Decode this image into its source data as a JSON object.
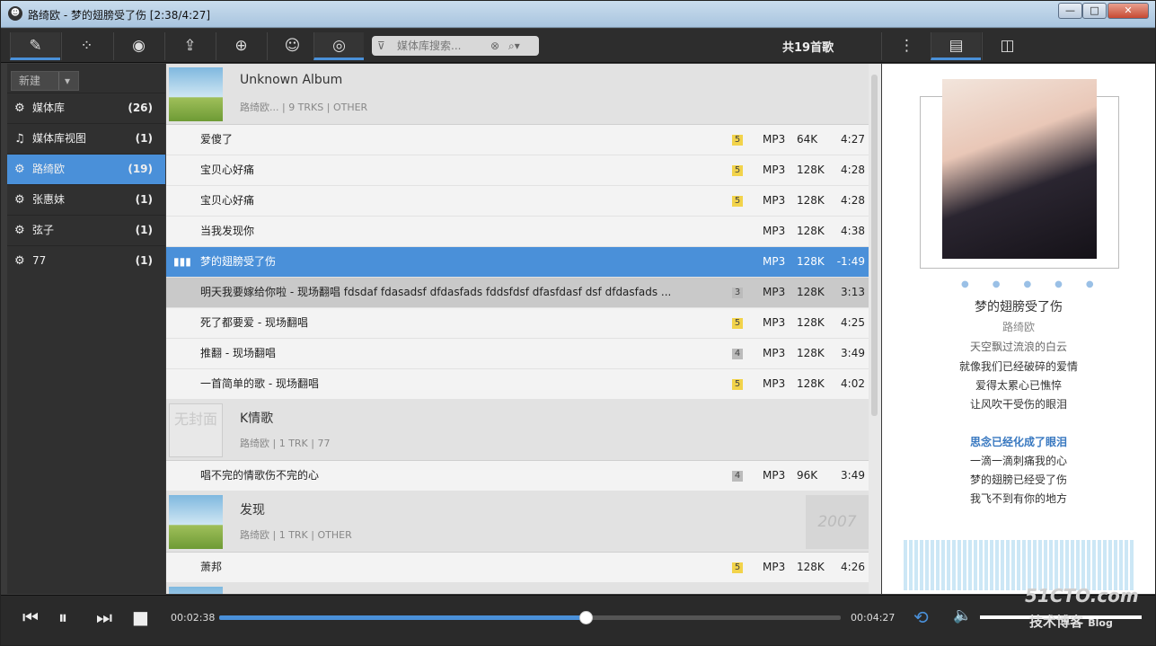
{
  "window": {
    "title": "路绮欧 - 梦的翅膀受了伤 [2:38/4:27]",
    "min": "—",
    "max": "□",
    "close": "✕"
  },
  "toolbar": {
    "search_placeholder": "媒体库搜索...",
    "track_count": "共19首歌"
  },
  "sidebar": {
    "new_label": "新建",
    "items": [
      {
        "label": "媒体库",
        "count": "(26)",
        "icon": "gear-icon"
      },
      {
        "label": "媒体库视图",
        "count": "(1)",
        "icon": "music-note-icon"
      },
      {
        "label": "路绮欧",
        "count": "(19)",
        "icon": "gear-icon"
      },
      {
        "label": "张惠妹",
        "count": "(1)",
        "icon": "gear-icon"
      },
      {
        "label": "弦子",
        "count": "(1)",
        "icon": "gear-icon"
      },
      {
        "label": "77",
        "count": "(1)",
        "icon": "gear-icon"
      }
    ]
  },
  "albums": [
    {
      "name": "Unknown Album",
      "meta": "路绮欧... | 9 TRKS | OTHER"
    },
    {
      "name": "K情歌",
      "meta": "路绮欧 | 1 TRK | 77",
      "cover_text": "无封面"
    },
    {
      "name": "发现",
      "meta": "路绮欧 | 1 TRK | OTHER",
      "year": "2007"
    }
  ],
  "tracks": [
    {
      "name": "爱傻了",
      "rating": "5",
      "format": "MP3",
      "bitrate": "64K",
      "duration": "4:27"
    },
    {
      "name": "宝贝心好痛",
      "rating": "5",
      "format": "MP3",
      "bitrate": "128K",
      "duration": "4:28"
    },
    {
      "name": "宝贝心好痛",
      "rating": "5",
      "format": "MP3",
      "bitrate": "128K",
      "duration": "4:28"
    },
    {
      "name": "当我发现你",
      "rating": "",
      "format": "MP3",
      "bitrate": "128K",
      "duration": "4:38"
    },
    {
      "name": "梦的翅膀受了伤",
      "rating": "",
      "format": "MP3",
      "bitrate": "128K",
      "duration": "-1:49"
    },
    {
      "name": "明天我要嫁给你啦 - 现场翻唱 fdsdaf fdasadsf dfdasfads fddsfdsf dfasfdasf dsf dfdasfads ...",
      "rating": "3",
      "format": "MP3",
      "bitrate": "128K",
      "duration": "3:13"
    },
    {
      "name": "死了都要爱 - 现场翻唱",
      "rating": "5",
      "format": "MP3",
      "bitrate": "128K",
      "duration": "4:25"
    },
    {
      "name": "推翻 - 现场翻唱",
      "rating": "4",
      "format": "MP3",
      "bitrate": "128K",
      "duration": "3:49"
    },
    {
      "name": "一首简单的歌 - 现场翻唱",
      "rating": "5",
      "format": "MP3",
      "bitrate": "128K",
      "duration": "4:02"
    },
    {
      "name": "唱不完的情歌伤不完的心",
      "rating": "4",
      "format": "MP3",
      "bitrate": "96K",
      "duration": "3:49"
    },
    {
      "name": "萧邦",
      "rating": "5",
      "format": "MP3",
      "bitrate": "128K",
      "duration": "4:26"
    }
  ],
  "now_playing": {
    "title": "梦的翅膀受了伤",
    "artist": "路绮欧",
    "lyrics": [
      "天空飘过流浪的白云",
      "就像我们已经破碎的爱情",
      "爱得太累心已憔悴",
      "让风吹干受伤的眼泪",
      "思念已经化成了眼泪",
      "一滴一滴刺痛我的心",
      "梦的翅膀已经受了伤",
      "我飞不到有你的地方"
    ]
  },
  "player": {
    "elapsed": "00:02:38",
    "total": "00:04:27",
    "progress": 0.59
  },
  "watermark": {
    "line1": "51CTO.com",
    "line2": "技术博客",
    "line3": "Blog"
  }
}
